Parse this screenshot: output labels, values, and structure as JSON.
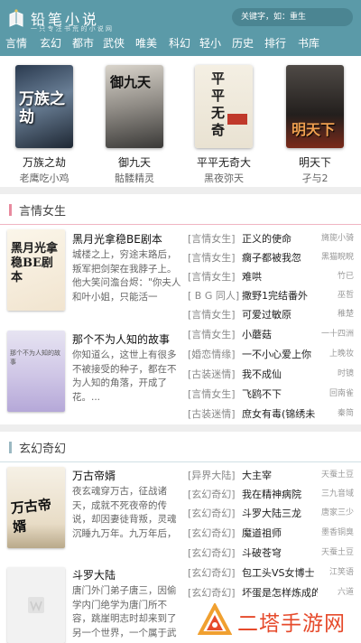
{
  "header": {
    "logo_title": "铅笔小说",
    "logo_subtitle": "一 只 专 注 书 荒 的 小 说 网",
    "search_placeholder": "关键字，如：重生"
  },
  "nav": [
    "言情",
    "玄幻",
    "都市",
    "武侠",
    "唯美",
    "科幻",
    "轻小",
    "历史",
    "排行",
    "书库"
  ],
  "top_books": [
    {
      "title": "万族之劫",
      "author": "老鹰吃小鸡",
      "cover_text": "万族之劫"
    },
    {
      "title": "御九天",
      "author": "骷髅精灵",
      "cover_text": "御九天"
    },
    {
      "title": "平平无奇大",
      "author": "黑夜弥天",
      "cover_text": "平平无奇"
    },
    {
      "title": "明天下",
      "author": "孑与2",
      "cover_text": "明天下"
    }
  ],
  "sections": [
    {
      "title": "言情女生",
      "accent": "#e88a9e",
      "featured": [
        {
          "title": "黑月光拿稳BE剧本",
          "desc": "城楼之上，穷途末路后，叛军把剑架在我脖子上。他大笑问澹台烬：\"你夫人和叶小姐，只能活一",
          "cover_text": "黑月光拿稳BE剧本"
        },
        {
          "title": "那个不为人知的故事",
          "desc": "你知道么，这世上有很多不被接受的种子，都在不为人知的角落，开成了花。...",
          "cover_text": "那个不为人知的故事"
        }
      ],
      "list": [
        {
          "tag": "[言情女生]",
          "name": "正义的使命",
          "author": "旖旎小骑"
        },
        {
          "tag": "[言情女生]",
          "name": "瘸子都被我忽",
          "author": "黑猫睨睨"
        },
        {
          "tag": "[言情女生]",
          "name": "难哄",
          "author": "竹已"
        },
        {
          "tag": "[ B G 同人]",
          "name": "撒野1完结番外",
          "author": "巫哲"
        },
        {
          "tag": "[言情女生]",
          "name": "可爱过敏原",
          "author": "稚楚"
        },
        {
          "tag": "[言情女生]",
          "name": "小蘑菇",
          "author": "一十四洲"
        },
        {
          "tag": "[婚恋情缘]",
          "name": "一不小心爱上你",
          "author": "上晚妆"
        },
        {
          "tag": "[古装迷情]",
          "name": "我不成仙",
          "author": "时镜"
        },
        {
          "tag": "[言情女生]",
          "name": "飞鸥不下",
          "author": "回南雀"
        },
        {
          "tag": "[古装迷情]",
          "name": "庶女有毒(锦绣未",
          "author": "秦简"
        }
      ]
    },
    {
      "title": "玄幻奇幻",
      "accent": "#9bb8c2",
      "featured": [
        {
          "title": "万古帝婿",
          "desc": "夜玄魂穿万古，征战诸天，成就不死夜帝的传说，却因妻徒背叛，灵魂沉睡九万年。九万年后，",
          "cover_text": "万古帝婿"
        },
        {
          "title": "斗罗大陆",
          "desc": "唐门外门弟子唐三，因偷学内门绝学为唐门所不容，跳崖明志时却来到了另一个世界，一个属于武",
          "cover_text": ""
        }
      ],
      "list": [
        {
          "tag": "[异界大陆]",
          "name": "大主宰",
          "author": "天蚕土豆"
        },
        {
          "tag": "[玄幻奇幻]",
          "name": "我在精神病院",
          "author": "三九音域"
        },
        {
          "tag": "[玄幻奇幻]",
          "name": "斗罗大陆三龙",
          "author": "唐家三少"
        },
        {
          "tag": "[玄幻奇幻]",
          "name": "魔道祖师",
          "author": "墨香铜臭"
        },
        {
          "tag": "[玄幻奇幻]",
          "name": "斗破苍穹",
          "author": "天蚕土豆"
        },
        {
          "tag": "[玄幻奇幻]",
          "name": "包工头VS女博士",
          "author": "江笑语"
        },
        {
          "tag": "[玄幻奇幻]",
          "name": "坏蛋是怎样炼成的",
          "author": "六道"
        }
      ]
    }
  ],
  "watermark": {
    "text": "二塔手游网"
  },
  "colors": {
    "header": "#5b9aa8",
    "accent_pink": "#e88a9e",
    "watermark": "#e64a2b"
  }
}
